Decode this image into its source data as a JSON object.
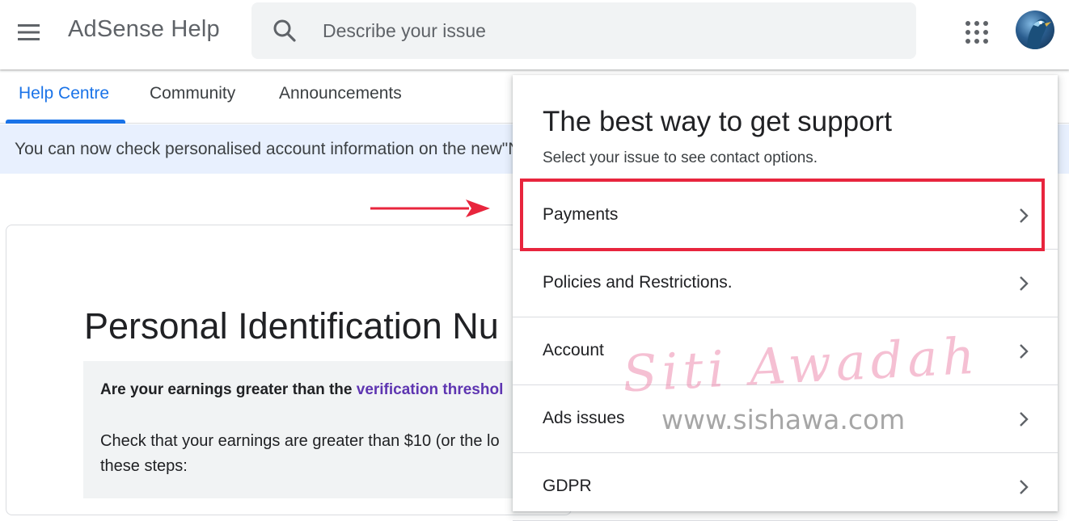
{
  "header": {
    "app_title": "AdSense Help",
    "search_placeholder": "Describe your issue"
  },
  "tabs": [
    {
      "label": "Help Centre",
      "active": true
    },
    {
      "label": "Community",
      "active": false
    },
    {
      "label": "Announcements",
      "active": false
    }
  ],
  "banner": {
    "text": "You can now check personalised account information on the new\"N"
  },
  "article": {
    "title": "Personal Identification Nu",
    "question_prefix": "Are your earnings greater than the ",
    "question_link": "verification threshol",
    "body_line1": "Check that your earnings are greater than $10 (or the lo",
    "body_line2": "these steps:"
  },
  "support_panel": {
    "title": "The best way to get support",
    "subtitle": "Select your issue to see contact options.",
    "options": [
      {
        "label": "Payments",
        "highlighted": true
      },
      {
        "label": "Policies and Restrictions.",
        "highlighted": false
      },
      {
        "label": "Account",
        "highlighted": false
      },
      {
        "label": "Ads issues",
        "highlighted": false
      },
      {
        "label": "GDPR",
        "highlighted": false
      }
    ]
  },
  "watermark": {
    "name": "Siti Awadah",
    "url": "www.sishawa.com"
  },
  "colors": {
    "accent": "#1a73e8",
    "banner_bg": "#e8f0fe",
    "highlight": "#e8253d",
    "link": "#5e35b1"
  },
  "icons": [
    "menu-icon",
    "search-icon",
    "apps-grid-icon",
    "avatar",
    "chevron-right-icon",
    "arrow-right-annotation"
  ]
}
